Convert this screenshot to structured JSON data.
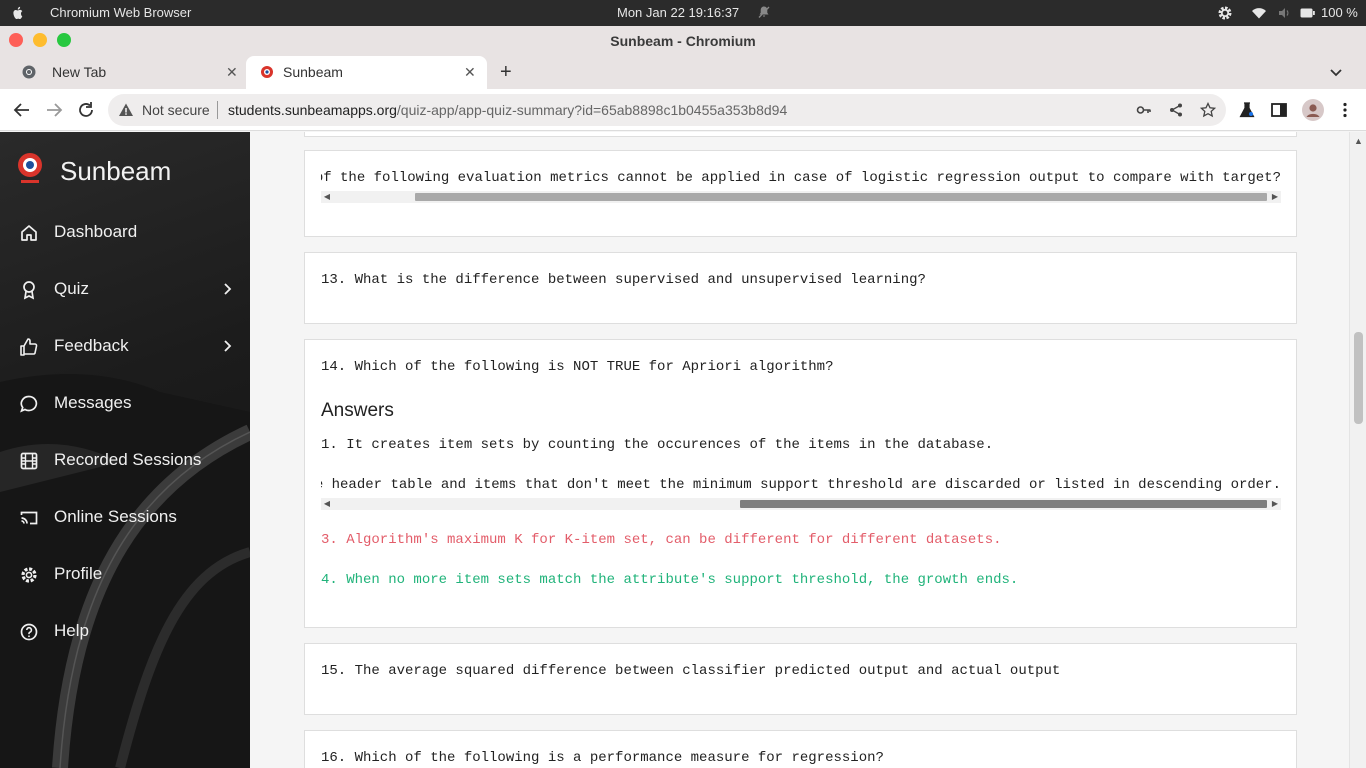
{
  "os": {
    "app_name": "Chromium Web Browser",
    "clock": "Mon Jan 22  19:16:37",
    "battery": "100 %"
  },
  "window": {
    "title": "Sunbeam - Chromium"
  },
  "tabs": [
    {
      "label": "New Tab"
    },
    {
      "label": "Sunbeam"
    }
  ],
  "address": {
    "security": "Not secure",
    "domain": "students.sunbeamapps.org",
    "path": "/quiz-app/app-quiz-summary?id=65ab8898c1b0455a353b8d94"
  },
  "sidebar": {
    "brand": "Sunbeam",
    "items": [
      {
        "label": "Dashboard",
        "icon": "home-icon"
      },
      {
        "label": "Quiz",
        "icon": "award-icon"
      },
      {
        "label": "Feedback",
        "icon": "thumbs-up-icon"
      },
      {
        "label": "Messages",
        "icon": "message-icon"
      },
      {
        "label": "Recorded Sessions",
        "icon": "film-icon"
      },
      {
        "label": "Online Sessions",
        "icon": "cast-icon"
      },
      {
        "label": "Profile",
        "icon": "gear-icon"
      },
      {
        "label": "Help",
        "icon": "help-icon"
      }
    ]
  },
  "quiz": {
    "q12_visible": "of the following evaluation metrics cannot be applied in case of logistic regression output to compare with target?",
    "q13": "13. What is the difference between supervised and unsupervised learning?",
    "q14": "14. Which of the following is NOT TRUE for Apriori algorithm?",
    "answers_heading": "Answers",
    "q14_answers": [
      "1. It creates item sets by counting the occurences of the items in the database.",
      "e header table and items that don't meet the minimum support threshold are discarded or listed in descending order.",
      "3. Algorithm's maximum K for K-item set, can be different for different datasets.",
      "4. When no more item sets match the attribute's support threshold, the growth ends."
    ],
    "q15": "15. The average squared difference between classifier predicted output and actual output",
    "q16": "16. Which of the following is a performance measure for regression?"
  },
  "colors": {
    "wrong_answer": "#e35d6a",
    "correct_answer": "#20b37a"
  }
}
